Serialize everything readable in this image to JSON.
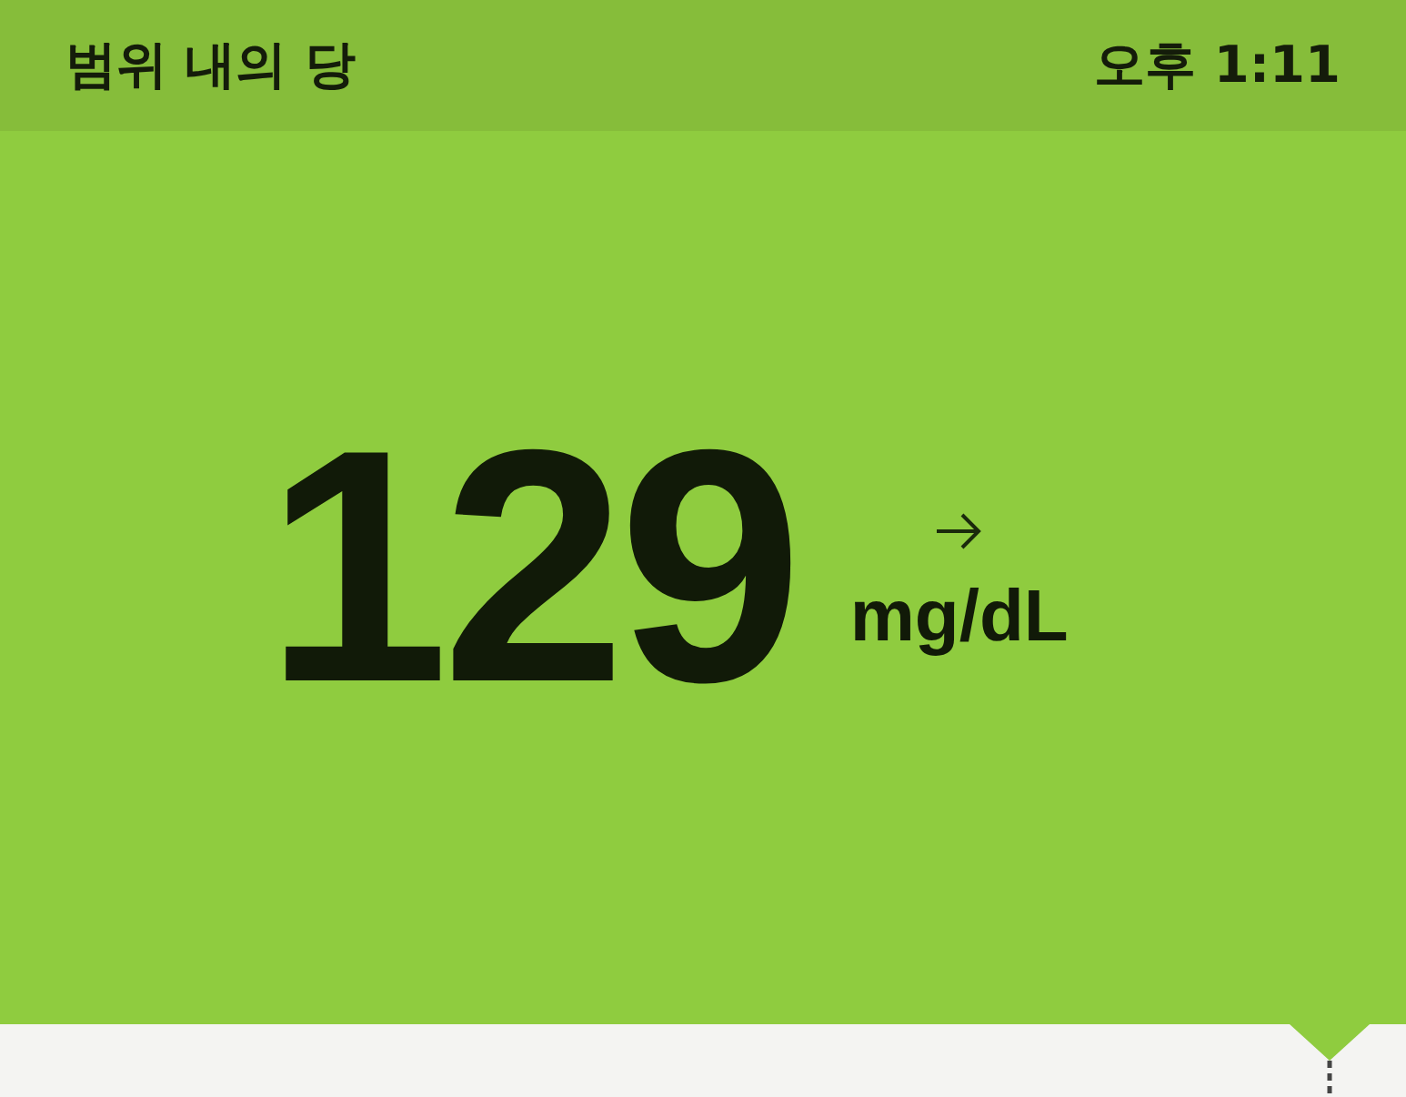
{
  "header": {
    "title": "범위 내의 당",
    "time": "오후 1:11"
  },
  "reading": {
    "value": "129",
    "unit": "mg/dL"
  }
}
